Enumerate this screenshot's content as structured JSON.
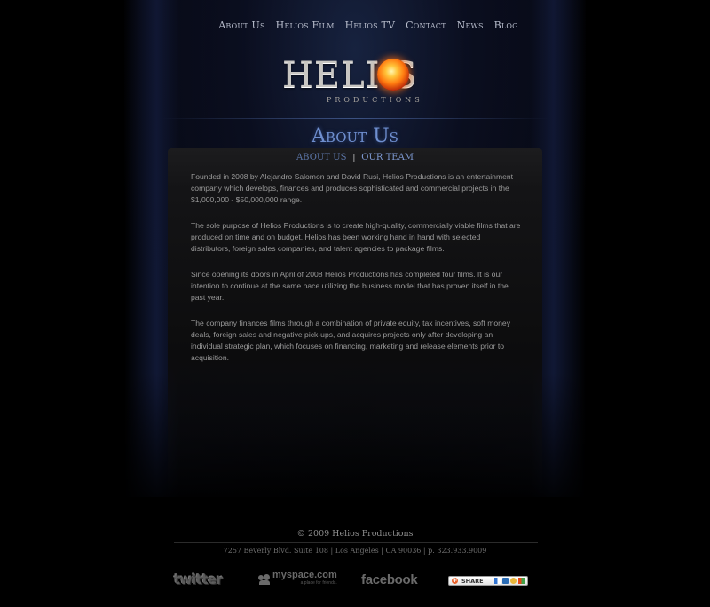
{
  "nav": {
    "items": [
      {
        "label": "About Us"
      },
      {
        "label": "Helios Film"
      },
      {
        "label": "Helios TV"
      },
      {
        "label": "Contact"
      },
      {
        "label": "News"
      },
      {
        "label": "Blog"
      }
    ]
  },
  "logo": {
    "word": "HELI  S",
    "subtitle": "PRODUCTIONS"
  },
  "page": {
    "title": "About Us"
  },
  "subnav": {
    "about_label": "ABOUT US",
    "separator": "|",
    "team_label": "OUR TEAM"
  },
  "content": {
    "paragraphs": [
      "Founded in 2008 by Alejandro Salomon and David Rusi, Helios Productions is an entertainment company which develops, finances and produces sophisticated and commercial projects in the $1,000,000 - $50,000,000 range.",
      "The sole purpose of Helios Productions is to create high-quality, commercially viable films that are produced on time and on budget. Helios has been working hand in hand with selected distributors, foreign sales companies, and talent agencies to package films.",
      "Since opening its doors in April of 2008 Helios Productions has completed four films. It is our intention to continue at the same pace utilizing the business model that has proven itself in the past year.",
      "The company finances films through a combination of private equity, tax incentives, soft money deals, foreign sales and negative pick-ups, and acquires projects only after developing an individual strategic plan, which focuses on financing, marketing and release elements prior to acquisition."
    ]
  },
  "footer": {
    "copyright": "© 2009 Helios Productions",
    "address": "7257 Beverly Blvd. Suite 108 | Los Angeles | CA 90036 | p. 323.933.9009"
  },
  "social": {
    "twitter": "twitter",
    "myspace": "myspace.com",
    "myspace_tagline": "a place for friends.",
    "facebook": "facebook",
    "share_label": "SHARE"
  },
  "colors": {
    "accent": "#6f8fcf",
    "nav_text": "#b7bccb",
    "body_text": "#9a9a9a",
    "background": "#000000"
  }
}
